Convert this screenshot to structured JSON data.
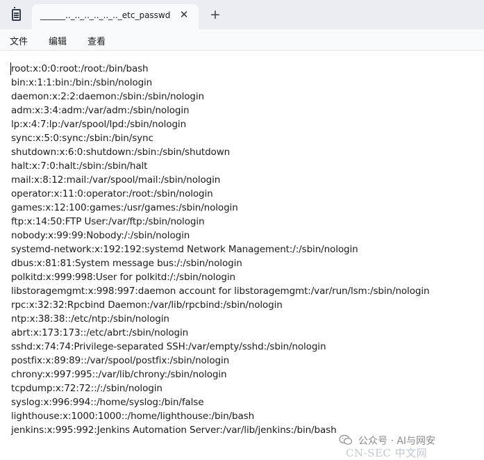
{
  "tab": {
    "title": "______.._.._.._.._.._.._etc_passwd"
  },
  "menu": {
    "file": "文件",
    "edit": "编辑",
    "view": "查看"
  },
  "content": {
    "lines": [
      "root:x:0:0:root:/root:/bin/bash",
      "bin:x:1:1:bin:/bin:/sbin/nologin",
      "daemon:x:2:2:daemon:/sbin:/sbin/nologin",
      "adm:x:3:4:adm:/var/adm:/sbin/nologin",
      "lp:x:4:7:lp:/var/spool/lpd:/sbin/nologin",
      "sync:x:5:0:sync:/sbin:/bin/sync",
      "shutdown:x:6:0:shutdown:/sbin:/sbin/shutdown",
      "halt:x:7:0:halt:/sbin:/sbin/halt",
      "mail:x:8:12:mail:/var/spool/mail:/sbin/nologin",
      "operator:x:11:0:operator:/root:/sbin/nologin",
      "games:x:12:100:games:/usr/games:/sbin/nologin",
      "ftp:x:14:50:FTP User:/var/ftp:/sbin/nologin",
      "nobody:x:99:99:Nobody:/:/sbin/nologin",
      "systemd-network:x:192:192:systemd Network Management:/:/sbin/nologin",
      "dbus:x:81:81:System message bus:/:/sbin/nologin",
      "polkitd:x:999:998:User for polkitd:/:/sbin/nologin",
      "libstoragemgmt:x:998:997:daemon account for libstoragemgmt:/var/run/lsm:/sbin/nologin",
      "rpc:x:32:32:Rpcbind Daemon:/var/lib/rpcbind:/sbin/nologin",
      "ntp:x:38:38::/etc/ntp:/sbin/nologin",
      "abrt:x:173:173::/etc/abrt:/sbin/nologin",
      "sshd:x:74:74:Privilege-separated SSH:/var/empty/sshd:/sbin/nologin",
      "postfix:x:89:89::/var/spool/postfix:/sbin/nologin",
      "chrony:x:997:995::/var/lib/chrony:/sbin/nologin",
      "tcpdump:x:72:72::/:/sbin/nologin",
      "syslog:x:996:994::/home/syslog:/bin/false",
      "lighthouse:x:1000:1000::/home/lighthouse:/bin/bash",
      "jenkins:x:995:992:Jenkins Automation Server:/var/lib/jenkins:/bin/bash"
    ]
  },
  "watermark": {
    "account": "公众号 · AI与网安",
    "brand": "CN-SEC 中文网"
  },
  "icons": {
    "app": "notepad-icon",
    "close": "close-icon",
    "new_tab": "plus-icon",
    "wechat": "wechat-icon"
  }
}
